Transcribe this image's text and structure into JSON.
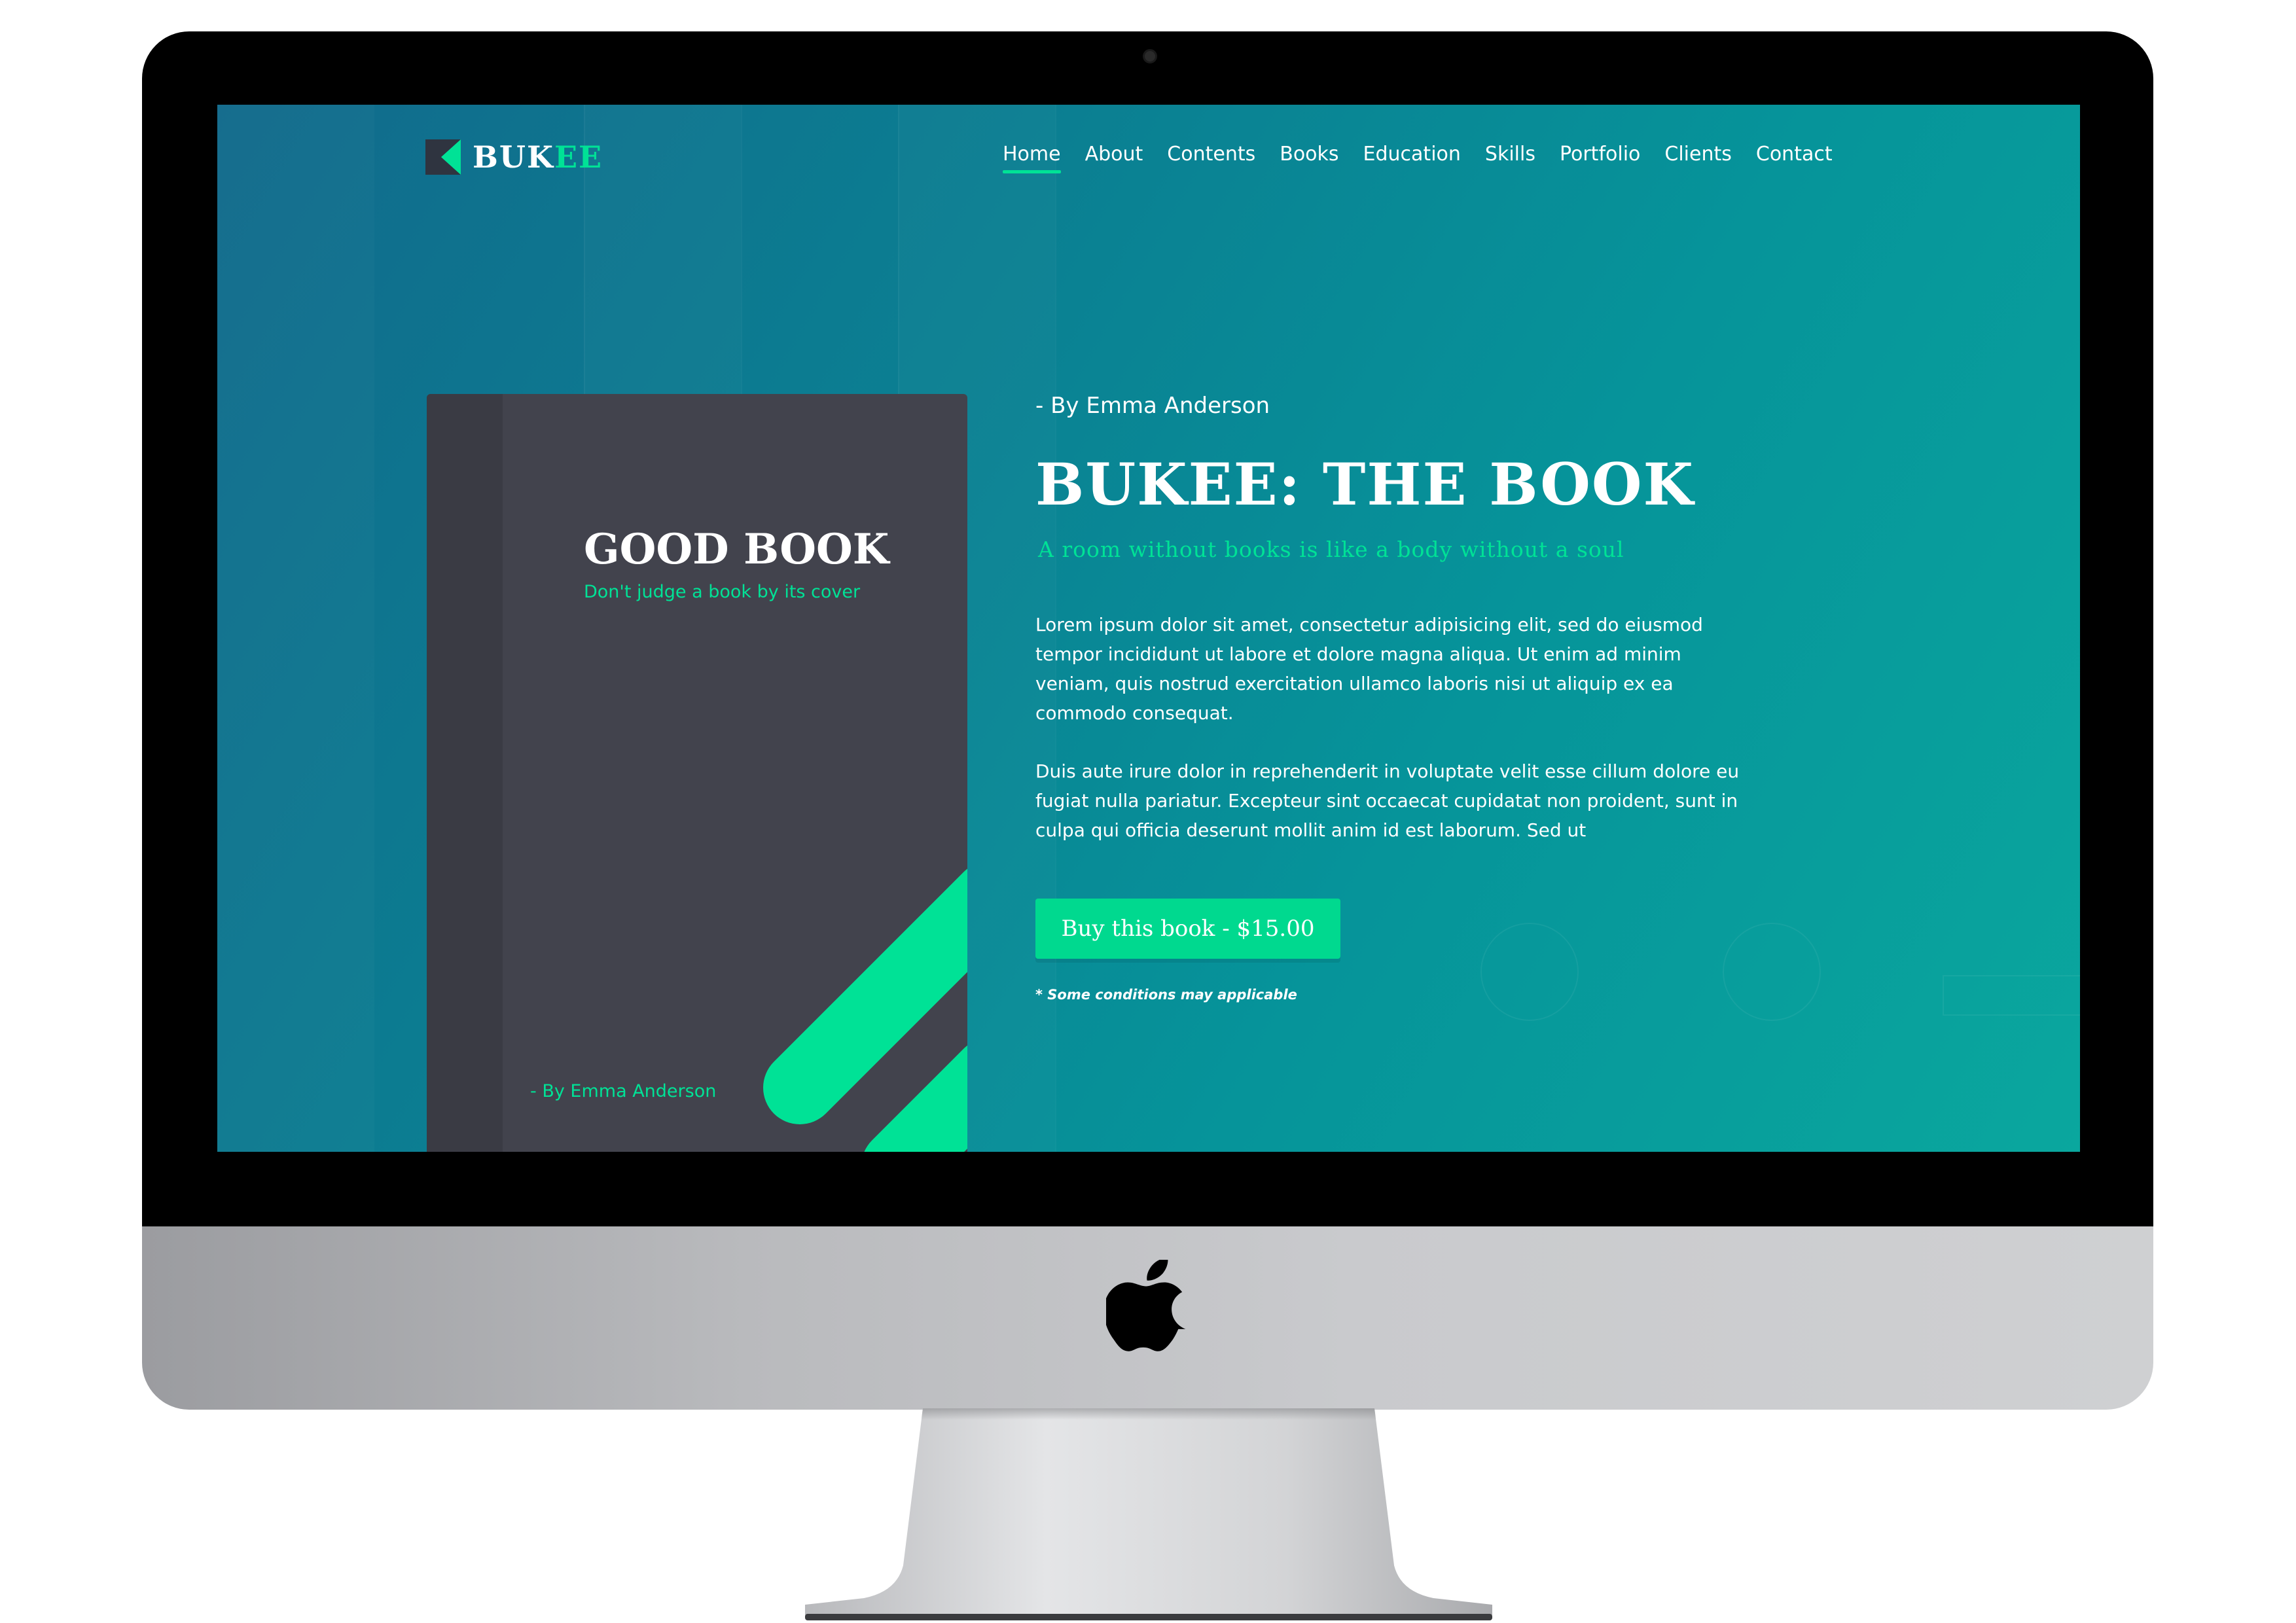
{
  "site": {
    "logo": {
      "text_main": "BUK",
      "text_accent": "EE"
    },
    "nav": {
      "items": [
        {
          "label": "Home",
          "active": true
        },
        {
          "label": "About",
          "active": false
        },
        {
          "label": "Contents",
          "active": false
        },
        {
          "label": "Books",
          "active": false
        },
        {
          "label": "Education",
          "active": false
        },
        {
          "label": "Skills",
          "active": false
        },
        {
          "label": "Portfolio",
          "active": false
        },
        {
          "label": "Clients",
          "active": false
        },
        {
          "label": "Contact",
          "active": false
        }
      ]
    },
    "book_cover": {
      "title": "GOOD BOOK",
      "tagline": "Don't judge a book by its cover",
      "author": "- By Emma Anderson"
    },
    "hero": {
      "byline": "- By Emma Anderson",
      "title": "BUKEE: THE BOOK",
      "subtitle": "A room without books is like a body without a soul",
      "paragraph_1": "Lorem ipsum dolor sit amet, consectetur adipisicing elit, sed do eiusmod tempor incididunt ut labore et dolore magna aliqua. Ut enim ad minim veniam, quis nostrud exercitation ullamco laboris nisi ut aliquip ex ea commodo consequat.",
      "paragraph_2": "Duis aute irure dolor in reprehenderit in voluptate velit esse cillum dolore eu fugiat nulla pariatur. Excepteur sint occaecat cupidatat non proident, sunt in culpa qui officia deserunt mollit anim id est laborum. Sed ut",
      "buy_button_label": "Buy this book - $15.00",
      "buy_note": "* Some conditions may applicable"
    }
  },
  "colors": {
    "accent": "#00e296",
    "book_cover": "#42434d",
    "bezel": "#000000",
    "background_start": "#116a8c",
    "background_end": "#0aa79e"
  },
  "icons": {
    "logo_mark": "logo-mark-icon",
    "apple_logo": "apple-logo-icon",
    "camera": "camera-icon"
  }
}
